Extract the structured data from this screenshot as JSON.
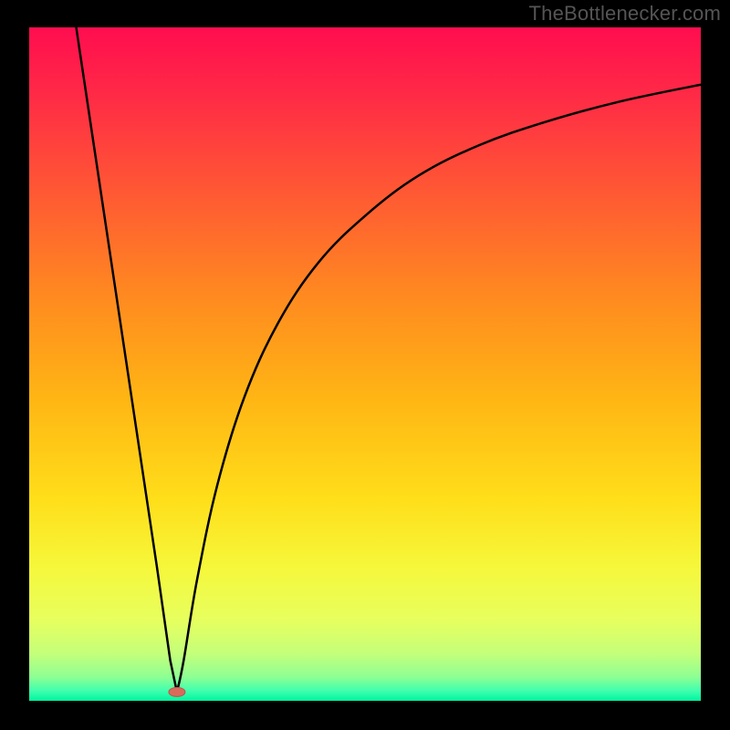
{
  "watermark": "TheBottlenecker.com",
  "colors": {
    "black": "#000000",
    "marker": "#d86a5c",
    "gradient_stops": [
      {
        "offset": 0.0,
        "color": "#ff0d4f"
      },
      {
        "offset": 0.1,
        "color": "#ff2a46"
      },
      {
        "offset": 0.25,
        "color": "#ff5a33"
      },
      {
        "offset": 0.4,
        "color": "#ff8a20"
      },
      {
        "offset": 0.55,
        "color": "#ffb514"
      },
      {
        "offset": 0.7,
        "color": "#ffde1a"
      },
      {
        "offset": 0.8,
        "color": "#f6f73a"
      },
      {
        "offset": 0.88,
        "color": "#e7ff5e"
      },
      {
        "offset": 0.93,
        "color": "#c4ff7a"
      },
      {
        "offset": 0.965,
        "color": "#8dff94"
      },
      {
        "offset": 0.985,
        "color": "#40ffae"
      },
      {
        "offset": 1.0,
        "color": "#00f5a0"
      }
    ]
  },
  "chart_data": {
    "type": "line",
    "title": "",
    "xlabel": "",
    "ylabel": "",
    "xlim": [
      0,
      100
    ],
    "ylim": [
      0,
      100
    ],
    "marker": {
      "x": 22,
      "y": 1.3
    },
    "series": [
      {
        "name": "left-branch",
        "x": [
          7,
          10,
          13,
          16,
          19,
          21,
          22
        ],
        "values": [
          100,
          80,
          60,
          40,
          20,
          6,
          1.3
        ]
      },
      {
        "name": "right-branch",
        "x": [
          22,
          23,
          25,
          28,
          32,
          37,
          43,
          50,
          58,
          67,
          77,
          88,
          100
        ],
        "values": [
          1.3,
          6,
          18,
          32,
          45,
          56,
          65,
          72,
          78,
          82.5,
          86,
          89,
          91.5
        ]
      }
    ]
  }
}
